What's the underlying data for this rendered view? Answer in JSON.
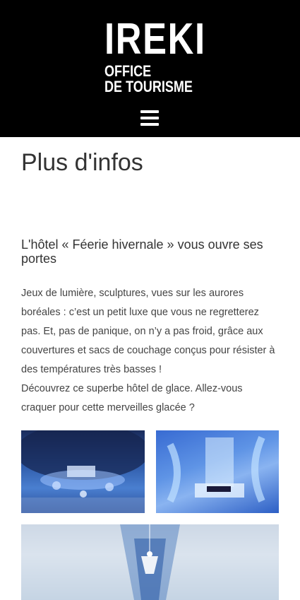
{
  "header": {
    "logo_main": "IREKI",
    "logo_line1": "OFFICE",
    "logo_line2": "DE TOURISME",
    "menu_icon": "hamburger-menu-icon"
  },
  "page": {
    "title": "Plus d'infos"
  },
  "article": {
    "title": "L'hôtel « Féerie hivernale » vous ouvre ses portes",
    "paragraph1": "Jeux de lumière, sculptures, vues sur les aurores boréales : c’est un petit luxe que vous ne regretterez pas. Et, pas de panique, on n’y a pas froid, grâce aux couvertures et sacs de couchage conçus pour résister à des températures très basses !",
    "paragraph2": "Découvrez ce superbe hôtel de glace. Allez-vous craquer pour cette merveilles glacée ?"
  },
  "colors": {
    "header_bg": "#000000",
    "text": "#333333",
    "ice_blue": "#4a7fd0"
  }
}
